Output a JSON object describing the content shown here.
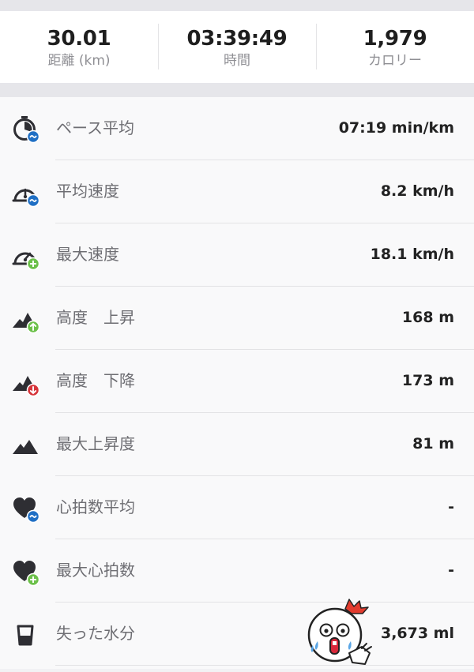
{
  "summary": [
    {
      "value": "30.01",
      "label": "距離 (km)"
    },
    {
      "value": "03:39:49",
      "label": "時間"
    },
    {
      "value": "1,979",
      "label": "カロリー"
    }
  ],
  "stats": [
    {
      "icon": "stopwatch-pace-icon",
      "label": "ペース平均",
      "value": "07:19 min/km"
    },
    {
      "icon": "speedometer-average-icon",
      "label": "平均速度",
      "value": "8.2 km/h"
    },
    {
      "icon": "speedometer-max-icon",
      "label": "最大速度",
      "value": "18.1 km/h"
    },
    {
      "icon": "mountain-ascent-icon",
      "label": "高度　上昇",
      "value": "168 m"
    },
    {
      "icon": "mountain-descent-icon",
      "label": "高度　下降",
      "value": "173 m"
    },
    {
      "icon": "mountain-max-icon",
      "label": "最大上昇度",
      "value": "81 m"
    },
    {
      "icon": "heart-average-icon",
      "label": "心拍数平均",
      "value": "-"
    },
    {
      "icon": "heart-max-icon",
      "label": "最大心拍数",
      "value": "-"
    },
    {
      "icon": "water-cup-icon",
      "label": "失った水分",
      "value": "3,673 ml"
    }
  ],
  "colors": {
    "badge_blue": "#1f6fc4",
    "badge_green": "#6cc04a",
    "badge_red": "#d6343a",
    "icon_dark": "#2e2e33"
  },
  "sticker": "crying-mascot-sticker"
}
